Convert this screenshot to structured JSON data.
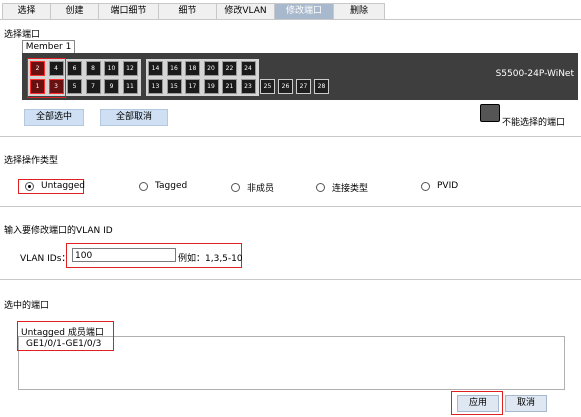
{
  "tabs": [
    {
      "label": "选择",
      "active": false
    },
    {
      "label": "创建",
      "active": false
    },
    {
      "label": "端口细节",
      "active": false
    },
    {
      "label": "细节",
      "active": false
    },
    {
      "label": "修改VLAN",
      "active": false
    },
    {
      "label": "修改端口",
      "active": true
    },
    {
      "label": "删除",
      "active": false
    }
  ],
  "select_ports": {
    "title": "选择端口",
    "member_tab": "Member 1",
    "device_model": "S5500-24P-WiNet",
    "top_row": [
      "2",
      "4",
      "6",
      "8",
      "10",
      "12",
      "14",
      "16",
      "18",
      "20",
      "22",
      "24"
    ],
    "bottom_row": [
      "1",
      "3",
      "5",
      "7",
      "9",
      "11",
      "13",
      "15",
      "17",
      "19",
      "21",
      "23"
    ],
    "fiber_ports": [
      "25",
      "26",
      "27",
      "28"
    ],
    "selected_ports": [
      "1",
      "2",
      "3"
    ],
    "select_all": "全部选中",
    "deselect_all": "全部取消",
    "legend_unselectable": "不能选择的端口"
  },
  "operation": {
    "title": "选择操作类型",
    "options": [
      {
        "label": "Untagged",
        "checked": true
      },
      {
        "label": "Tagged",
        "checked": false
      },
      {
        "label": "非成员",
        "checked": false
      },
      {
        "label": "连接类型",
        "checked": false
      },
      {
        "label": "PVID",
        "checked": false
      }
    ]
  },
  "vlan": {
    "title": "输入要修改端口的VLAN ID",
    "label": "VLAN IDs：",
    "value": "100",
    "example": "例如：1,3,5-10"
  },
  "selected": {
    "title": "选中的端口",
    "group_title": "Untagged 成员端口",
    "ports": "GE1/0/1-GE1/0/3"
  },
  "buttons": {
    "apply": "应用",
    "cancel": "取消"
  },
  "colors": {
    "highlight": "#e02020",
    "active_tab": "#a9b9cd",
    "device": "#3e3e3e"
  }
}
